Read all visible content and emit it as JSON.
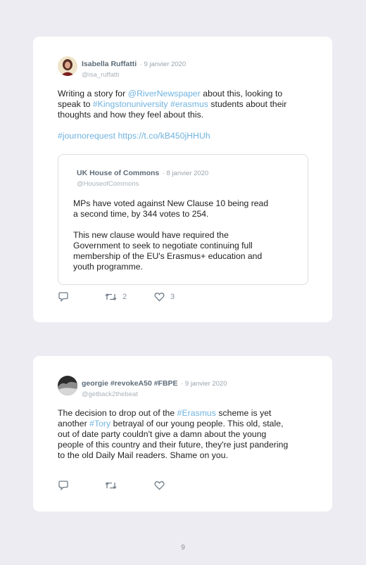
{
  "tweet1": {
    "name": "Isabella Ruffatti",
    "date": "· 9 janvier 2020",
    "handle": "@isa_ruffatti",
    "line1_a": "Writing a story for ",
    "line1_link": "@RiverNewspaper",
    "line1_b": " about this, looking to",
    "line2_a": "speak to ",
    "line2_link1": "#Kingstonuniversity",
    "line2_sp": " ",
    "line2_link2": "#erasmus",
    "line2_b": " students about their",
    "line3": "thoughts and how they feel about this.",
    "line4_link1": "#journorequest",
    "line4_sp": " ",
    "line4_link2": "https://t.co/kB450jHHUh",
    "retweets": "2",
    "likes": "3",
    "quote": {
      "name": "UK House of Commons",
      "date": "· 8 janvier 2020",
      "handle": "@HouseofCommons",
      "lines": [
        "MPs have voted against New Clause 10 being read",
        "a second time, by 344 votes to 254.",
        "This new clause would have required the",
        "Government to seek to negotiate continuing full",
        "membership of the EU's Erasmus+ education and",
        "youth programme."
      ]
    }
  },
  "tweet2": {
    "name": "georgie #revokeA50 #FBPE",
    "date": "· 9 janvier 2020",
    "handle": "@getback2thebeat",
    "line1_a": "The decision to drop out of the ",
    "line1_link": "#Erasmus",
    "line1_b": " scheme is yet",
    "line2_a": "another ",
    "line2_link": "#Tory",
    "line2_b": " betrayal of our young people. This old, stale,",
    "line3": "out of date party couldn't give a damn about the young",
    "line4": "people of this country and their future, they're just pandering",
    "line5": "to the old Daily Mail readers. Shame on you."
  },
  "page_number": "9",
  "colors": {
    "background": "#ececf2",
    "card": "#ffffff",
    "link": "#6fb2de",
    "name": "#5c6b78",
    "muted": "#9aa4ad"
  },
  "icons": [
    "reply-icon",
    "retweet-icon",
    "like-icon"
  ]
}
